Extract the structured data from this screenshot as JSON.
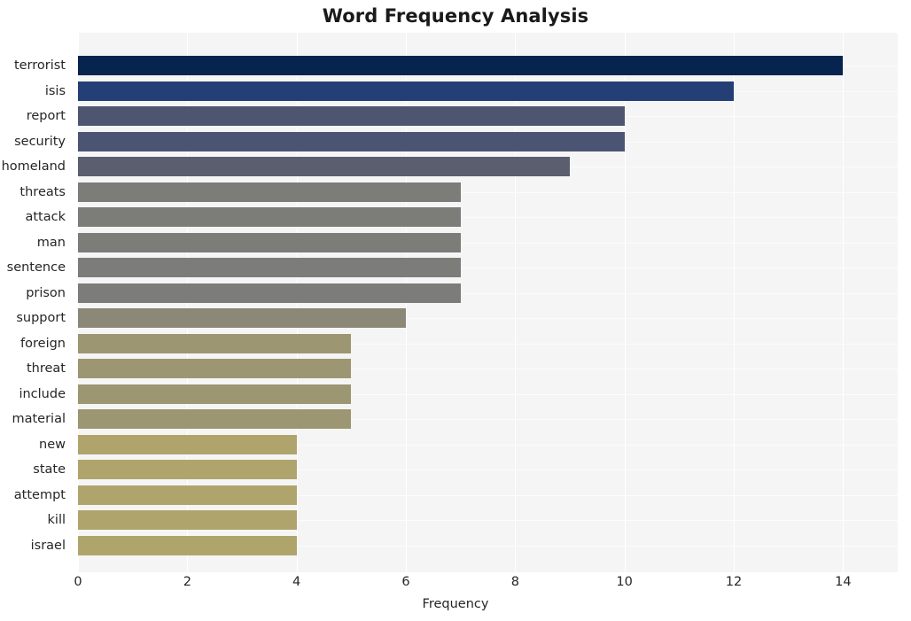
{
  "chart_data": {
    "type": "bar",
    "orientation": "horizontal",
    "title": "Word Frequency Analysis",
    "xlabel": "Frequency",
    "ylabel": "",
    "xlim": [
      0,
      15
    ],
    "xticks": [
      0,
      2,
      4,
      6,
      8,
      10,
      12,
      14
    ],
    "xtick_labels": [
      "0",
      "2",
      "4",
      "6",
      "8",
      "10",
      "12",
      "14"
    ],
    "grid": true,
    "grid_axis": "both",
    "legend": false,
    "categories": [
      "terrorist",
      "isis",
      "report",
      "security",
      "homeland",
      "threats",
      "attack",
      "man",
      "sentence",
      "prison",
      "support",
      "foreign",
      "threat",
      "include",
      "material",
      "new",
      "state",
      "attempt",
      "kill",
      "israel"
    ],
    "values": [
      14,
      12,
      10,
      10,
      9,
      7,
      7,
      7,
      7,
      7,
      6,
      5,
      5,
      5,
      5,
      4,
      4,
      4,
      4,
      4
    ],
    "bar_colors": [
      "#06244d",
      "#243f75",
      "#4d5570",
      "#4b5472",
      "#5a5e6e",
      "#7c7c79",
      "#7c7c79",
      "#7c7c79",
      "#7c7c79",
      "#7c7c7a",
      "#8c8878",
      "#9d9673",
      "#9d9673",
      "#9d9673",
      "#9d9673",
      "#b0a46d",
      "#b0a46d",
      "#b0a46d",
      "#b0a46d",
      "#b0a46d"
    ],
    "plot_background": "#f5f5f5",
    "figure_background": "#ffffff",
    "gridline_color": "#ffffff"
  }
}
